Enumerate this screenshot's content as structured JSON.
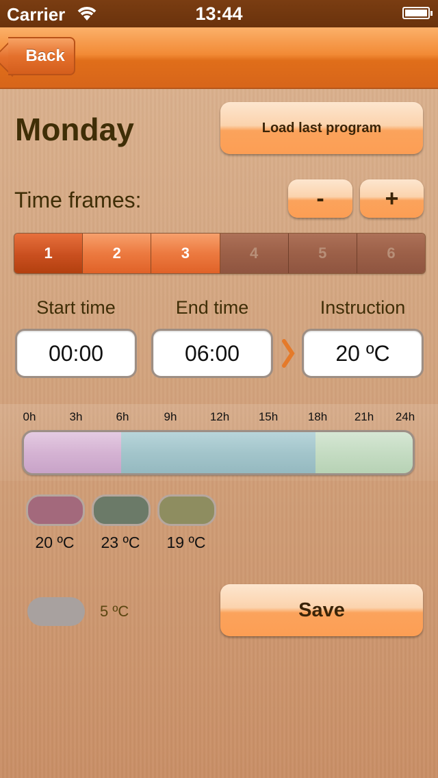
{
  "status_bar": {
    "carrier": "Carrier",
    "time": "13:44"
  },
  "nav": {
    "back_label": "Back"
  },
  "page": {
    "title": "Monday",
    "load_button": "Load last program"
  },
  "time_frames": {
    "label": "Time frames:",
    "minus": "-",
    "plus": "+",
    "segments": [
      {
        "label": "1",
        "state": "selected"
      },
      {
        "label": "2",
        "state": "active"
      },
      {
        "label": "3",
        "state": "active"
      },
      {
        "label": "4",
        "state": "inactive"
      },
      {
        "label": "5",
        "state": "inactive"
      },
      {
        "label": "6",
        "state": "inactive"
      }
    ]
  },
  "frame_editor": {
    "start_label": "Start time",
    "end_label": "End time",
    "instruction_label": "Instruction",
    "start_value": "00:00",
    "end_value": "06:00",
    "instruction_value": "20 ºC"
  },
  "timeline": {
    "ticks": [
      "0h",
      "3h",
      "6h",
      "9h",
      "12h",
      "15h",
      "18h",
      "21h",
      "24h"
    ],
    "segments": [
      {
        "from_hour": 0,
        "to_hour": 6,
        "color": "#d5b3d3"
      },
      {
        "from_hour": 6,
        "to_hour": 18,
        "color": "#a3c5cb"
      },
      {
        "from_hour": 18,
        "to_hour": 24,
        "color": "#c5dcc3"
      }
    ]
  },
  "legend": [
    {
      "label": "20 ºC",
      "color": "#a3697c"
    },
    {
      "label": "23 ºC",
      "color": "#6b7a68"
    },
    {
      "label": "19 ºC",
      "color": "#8e8d60"
    }
  ],
  "off": {
    "label": "5 ºC",
    "color": "#a8a19f"
  },
  "save_button": "Save",
  "colors": {
    "accent": "#e4702c",
    "title_text": "#3f2e07"
  }
}
